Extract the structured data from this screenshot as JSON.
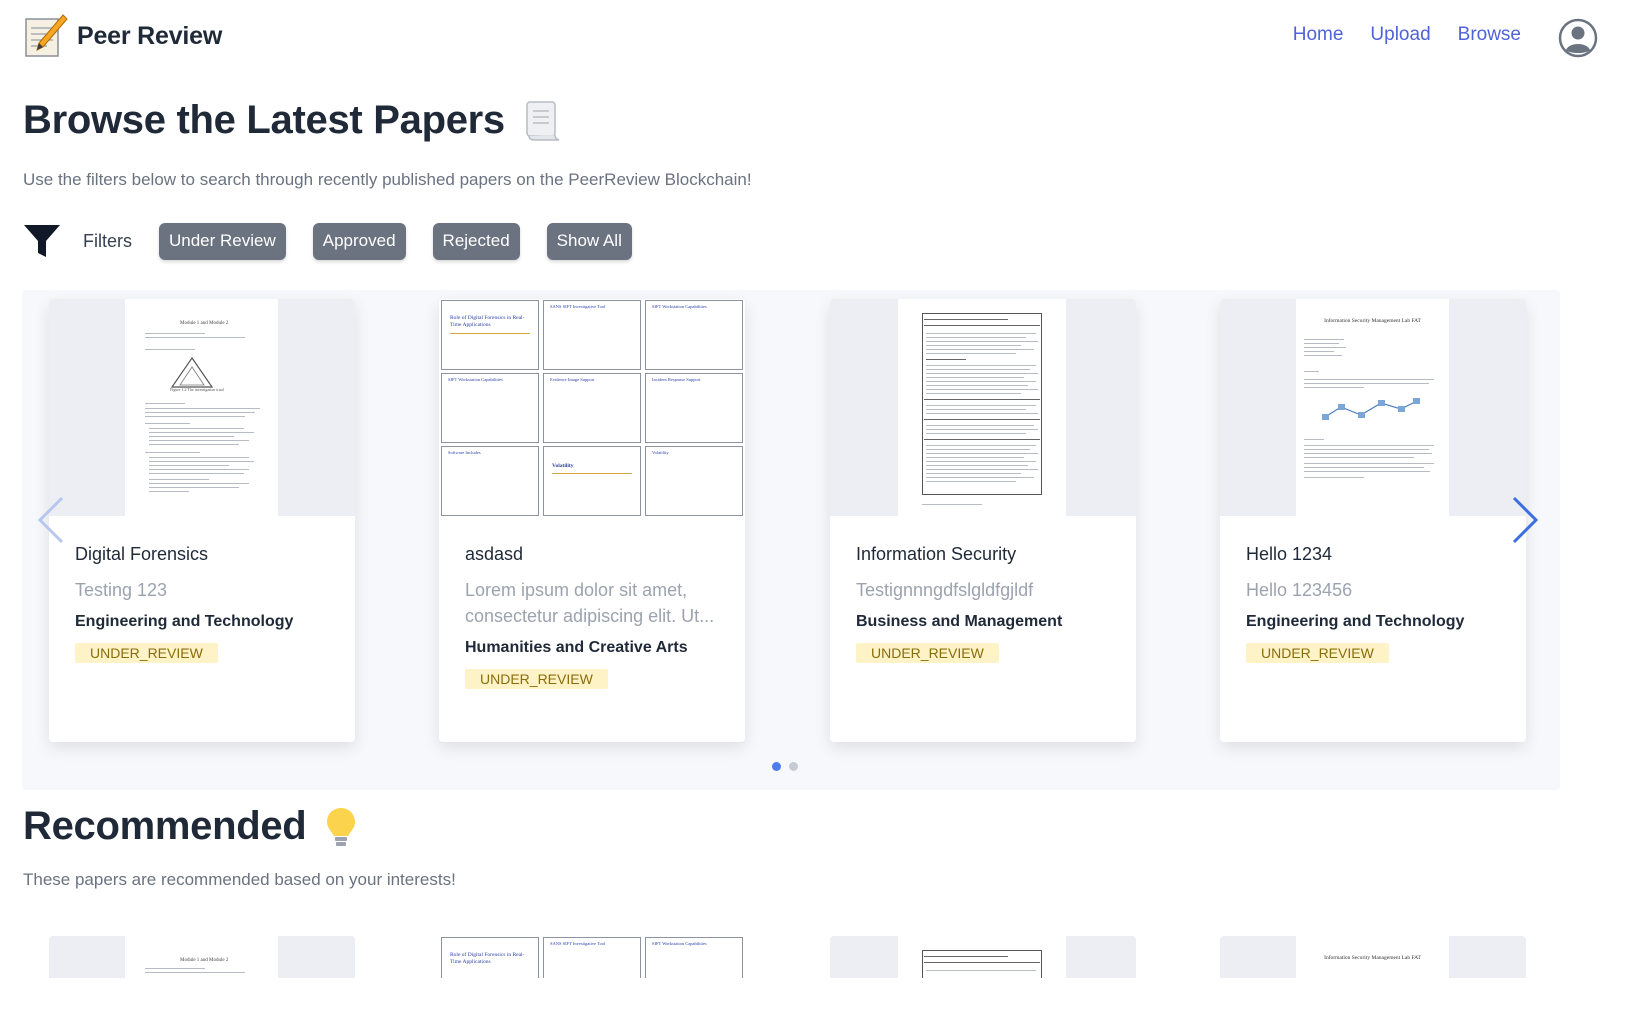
{
  "brand": {
    "name": "Peer Review",
    "icon": "notepad-pencil-icon"
  },
  "nav": {
    "home": "Home",
    "upload": "Upload",
    "browse": "Browse",
    "avatar_icon": "user-avatar-icon"
  },
  "browse": {
    "title": "Browse the Latest Papers",
    "title_icon": "scroll-icon",
    "subtitle": "Use the filters below to search through recently published papers on the PeerReview Blockchain!"
  },
  "filters": {
    "icon": "funnel-icon",
    "label": "Filters",
    "buttons": [
      "Under Review",
      "Approved",
      "Rejected",
      "Show All"
    ]
  },
  "carousel": {
    "prev_icon": "chevron-left-icon",
    "next_icon": "chevron-right-icon",
    "cards": [
      {
        "title": "Digital Forensics",
        "description": "Testing 123",
        "field": "Engineering and Technology",
        "status": "UNDER_REVIEW"
      },
      {
        "title": "asdasd",
        "description": "Lorem ipsum dolor sit amet, consectetur adipiscing elit. Ut...",
        "field": "Humanities and Creative Arts",
        "status": "UNDER_REVIEW"
      },
      {
        "title": "Information Security",
        "description": "Testignnngdfslgldfgjldf",
        "field": "Business and Management",
        "status": "UNDER_REVIEW"
      },
      {
        "title": "Hello 1234",
        "description": "Hello 123456",
        "field": "Engineering and Technology",
        "status": "UNDER_REVIEW"
      }
    ],
    "page_count": 2,
    "active_page": 1
  },
  "thumbnails": {
    "card1": {
      "heading": "Module 1 and Module 2",
      "caption": "Figure 1.2 The investigation triad"
    },
    "card2": {
      "slides": [
        "Role of Digital Forensics in Real-Time Applications",
        "SANS SIFT Investigative Tool",
        "SIFT Workstation Capabilities",
        "SIFT Workstation Capabilities",
        "Evidence Image Support",
        "Incident Response Support",
        "Software Includes",
        "Volatility",
        "Volatility"
      ]
    },
    "card4": {
      "heading": "Information Security Management Lab FAT"
    }
  },
  "recommended": {
    "title": "Recommended",
    "title_icon": "lightbulb-icon",
    "subtitle": "These papers are recommended based on your interests!"
  },
  "colors": {
    "accent": "#4f63d9",
    "filter_button": "#6b7280",
    "status_bg": "#fef3c7",
    "status_text": "#8a6d0b"
  }
}
